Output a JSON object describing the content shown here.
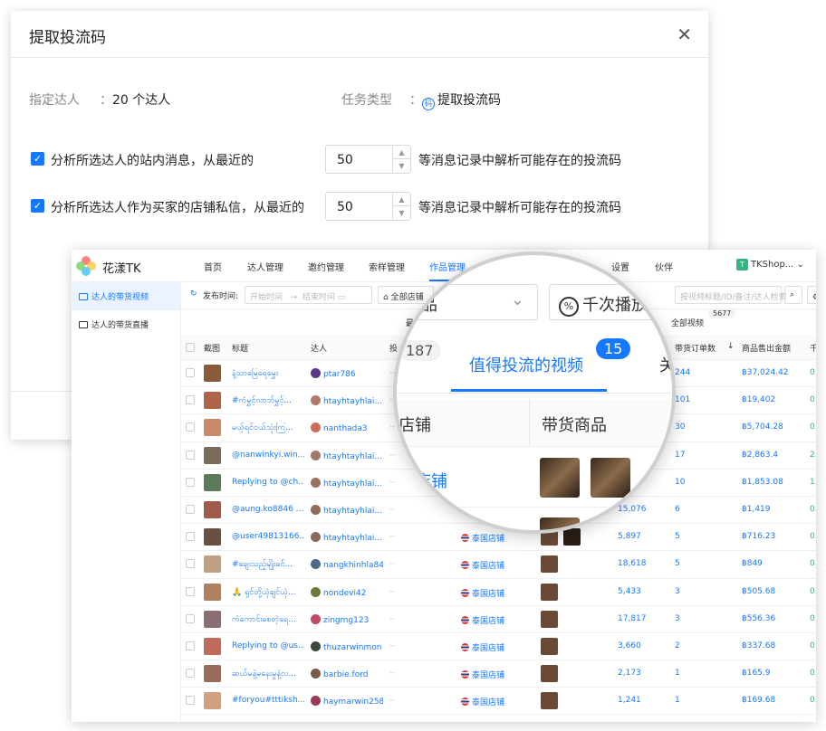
{
  "dialog": {
    "title": "提取投流码",
    "close_icon": "close-icon",
    "assignee_label": "指定达人",
    "assignee_value": "20 个达人",
    "task_type_label": "任务类型",
    "task_type_value": "提取投流码",
    "option1": {
      "text": "分析所选达人的站内消息，从最近的",
      "value": "50",
      "suffix": "等消息记录中解析可能存在的投流码",
      "checked": true
    },
    "option2": {
      "text": "分析所选达人作为买家的店铺私信，从最近的",
      "value": "50",
      "suffix": "等消息记录中解析可能存在的投流码",
      "checked": true
    },
    "colon": "："
  },
  "app": {
    "brand": "花漾TK",
    "nav": [
      "首页",
      "达人管理",
      "邀约管理",
      "索样管理",
      "作品管理",
      "设置",
      "伙伴"
    ],
    "active_nav": "作品管理",
    "shop": "TKShop...",
    "shop_badge": "T",
    "sidebar": [
      "达人的带货视频",
      "达人的带货直播"
    ],
    "filter": {
      "publish_time": "发布时间:",
      "start_placeholder": "开始时间",
      "end_placeholder": "结束时间",
      "arrow": "→",
      "all_shops": "全部店铺",
      "search_placeholder": "按视频标题/ID/备注/达人检索",
      "field_btn": "字段"
    },
    "subtabs": {
      "left": "最",
      "all_videos": "全部视频",
      "all_count": "5677"
    },
    "columns": [
      "截图",
      "标题",
      "达人",
      "投",
      "带货订单数",
      "商品售出金额",
      "千"
    ],
    "rows": [
      {
        "title": "နံ့သာမြေရေမွှေး",
        "creator": "ptar786",
        "shop": "",
        "views": "",
        "orders": "244",
        "amount": "฿37,024.42",
        "extra": "0."
      },
      {
        "title": "#ကံမွှင့်လာဘ်မွှင့်...",
        "creator": "htayhtayhlai...",
        "shop": "",
        "views": "",
        "orders": "101",
        "amount": "฿19,402",
        "extra": "0."
      },
      {
        "title": "မယ့်ရင်ဝယ်သုံးကြ...",
        "creator": "nanthada3",
        "shop": "",
        "views": "",
        "orders": "30",
        "amount": "฿5,704.28",
        "extra": "0."
      },
      {
        "title": "@nanwinkyi.win...",
        "creator": "htayhtayhlai...",
        "shop": "",
        "views": "",
        "orders": "17",
        "amount": "฿2,863.4",
        "extra": "2."
      },
      {
        "title": "Replying to @ch...",
        "creator": "htayhtayhlai...",
        "shop": "",
        "views": "",
        "orders": "10",
        "amount": "฿1,853.08",
        "extra": "1."
      },
      {
        "title": "@aung.ko8846 ...",
        "creator": "htayhtayhlai...",
        "shop": "",
        "views": "15,076",
        "orders": "6",
        "amount": "฿1,419",
        "extra": "0."
      },
      {
        "title": "@user49813166...",
        "creator": "htayhtayhlai...",
        "shop": "泰国店铺",
        "views": "5,897",
        "orders": "5",
        "amount": "฿716.23",
        "extra": "0."
      },
      {
        "title": "#ချေးသည့်မျိုးခင်...",
        "creator": "nangkhinhla84",
        "shop": "泰国店铺",
        "views": "18,618",
        "orders": "5",
        "amount": "฿849",
        "extra": "0."
      },
      {
        "title": "🙏 ရှင်တို့ယုံချင်ယုံ...",
        "creator": "nondevi42",
        "shop": "泰国店铺",
        "views": "5,433",
        "orders": "3",
        "amount": "฿505.68",
        "extra": "0."
      },
      {
        "title": "ကံကောင်းစေတဲ့ရေ...",
        "creator": "zingmg123",
        "shop": "泰国店铺",
        "views": "17,817",
        "orders": "3",
        "amount": "฿556.36",
        "extra": "0."
      },
      {
        "title": "Replying to @us...",
        "creator": "thuzarwinmon",
        "shop": "泰国店铺",
        "views": "3,660",
        "orders": "2",
        "amount": "฿337.68",
        "extra": "0."
      },
      {
        "title": "ဆယ်မနဲ့မနေးမှုနဲ့လ...",
        "creator": "barbie.ford",
        "shop": "泰国店铺",
        "views": "2,173",
        "orders": "1",
        "amount": "฿165.9",
        "extra": "0."
      },
      {
        "title": "#foryou#tttiksh...",
        "creator": "haymarwin258",
        "shop": "泰国店铺",
        "views": "1,241",
        "orders": "1",
        "amount": "฿169.68",
        "extra": "0."
      }
    ],
    "dash": "--"
  },
  "magnifier": {
    "all_goods": "部商品",
    "views_filter": "千次播放",
    "tab_count_gray": "187",
    "tab_active": "值得投流的视频",
    "tab_active_count": "15",
    "tab_next": "关",
    "col_shop": "店铺",
    "col_goods": "带货商品",
    "shop_value": "国店铺"
  }
}
